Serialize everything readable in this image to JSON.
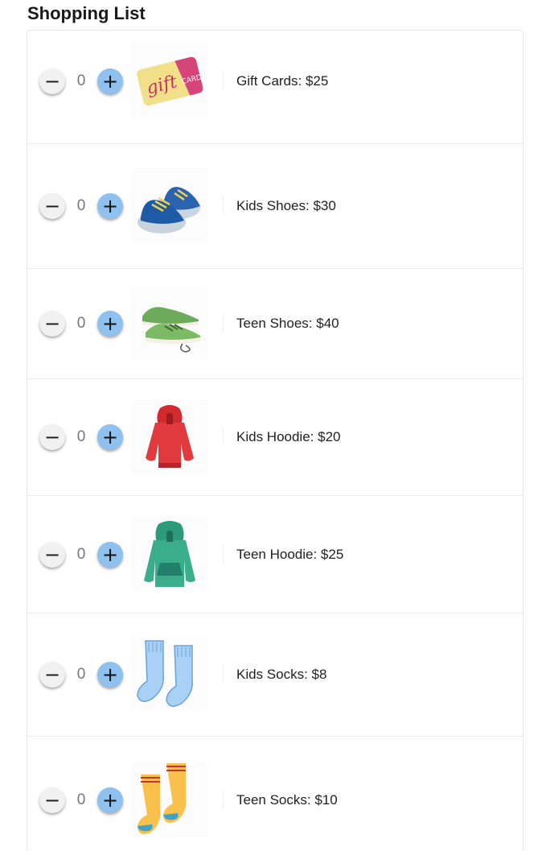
{
  "page": {
    "title": "Shopping List"
  },
  "items": [
    {
      "label": "Gift Cards: $25",
      "quantity": "0",
      "icon": "gift-card-icon"
    },
    {
      "label": "Kids Shoes: $30",
      "quantity": "0",
      "icon": "kids-shoes-icon"
    },
    {
      "label": "Teen Shoes: $40",
      "quantity": "0",
      "icon": "teen-shoes-icon"
    },
    {
      "label": "Kids Hoodie: $20",
      "quantity": "0",
      "icon": "kids-hoodie-icon"
    },
    {
      "label": "Teen Hoodie: $25",
      "quantity": "0",
      "icon": "teen-hoodie-icon"
    },
    {
      "label": "Kids Socks: $8",
      "quantity": "0",
      "icon": "kids-socks-icon"
    },
    {
      "label": "Teen Socks: $10",
      "quantity": "0",
      "icon": "teen-socks-icon"
    }
  ],
  "controls": {
    "minus_symbol": "−",
    "plus_symbol": "+"
  },
  "colors": {
    "plus_button": "#8fc1ef",
    "minus_button": "#f1f1f1",
    "border": "#e6e6e6"
  }
}
